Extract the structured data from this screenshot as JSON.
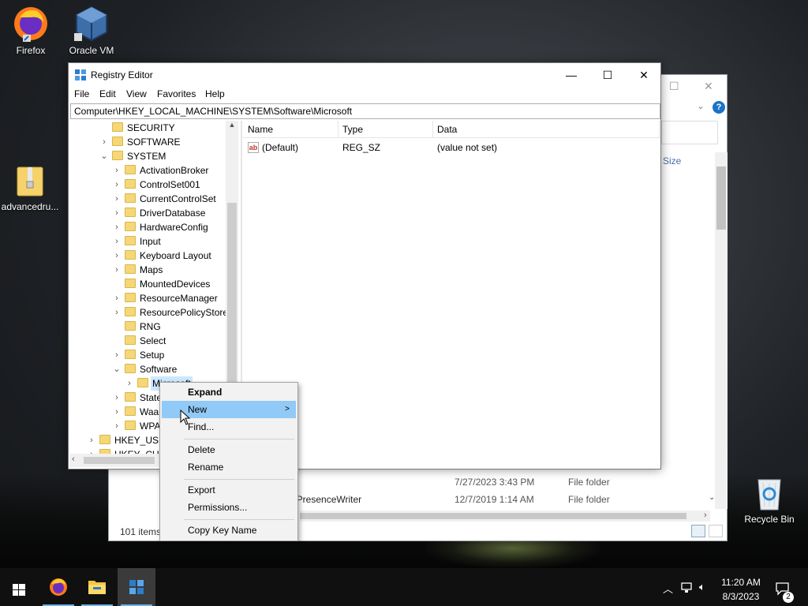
{
  "desktop": {
    "icons": [
      {
        "label": "Firefox"
      },
      {
        "label": "Oracle VM VirtualBox"
      },
      {
        "label": "advancedru..."
      },
      {
        "label": "Recycle Bin"
      }
    ]
  },
  "explorer": {
    "column_size": "Size",
    "rows": [
      {
        "name": "",
        "date": "7/27/2023 3:43 PM",
        "type": "File folder"
      },
      {
        "name": "arPresenceWriter",
        "date": "12/7/2019 1:14 AM",
        "type": "File folder"
      }
    ],
    "status": "101 items"
  },
  "regedit": {
    "title": "Registry Editor",
    "menu": [
      "File",
      "Edit",
      "View",
      "Favorites",
      "Help"
    ],
    "address": "Computer\\HKEY_LOCAL_MACHINE\\SYSTEM\\Software\\Microsoft",
    "tree": [
      {
        "label": "SECURITY",
        "arrow": ""
      },
      {
        "label": "SOFTWARE",
        "arrow": ">"
      },
      {
        "label": "SYSTEM",
        "arrow": "v"
      },
      {
        "label": "ActivationBroker",
        "arrow": ">"
      },
      {
        "label": "ControlSet001",
        "arrow": ">"
      },
      {
        "label": "CurrentControlSet",
        "arrow": ">"
      },
      {
        "label": "DriverDatabase",
        "arrow": ">"
      },
      {
        "label": "HardwareConfig",
        "arrow": ">"
      },
      {
        "label": "Input",
        "arrow": ">"
      },
      {
        "label": "Keyboard Layout",
        "arrow": ">"
      },
      {
        "label": "Maps",
        "arrow": ">"
      },
      {
        "label": "MountedDevices",
        "arrow": ""
      },
      {
        "label": "ResourceManager",
        "arrow": ">"
      },
      {
        "label": "ResourcePolicyStore",
        "arrow": ">"
      },
      {
        "label": "RNG",
        "arrow": ""
      },
      {
        "label": "Select",
        "arrow": ""
      },
      {
        "label": "Setup",
        "arrow": ">"
      },
      {
        "label": "Software",
        "arrow": "v"
      },
      {
        "label": "Microsoft",
        "arrow": ">"
      },
      {
        "label": "State",
        "arrow": ">"
      },
      {
        "label": "WaaS",
        "arrow": ">"
      },
      {
        "label": "WPA",
        "arrow": ">"
      },
      {
        "label": "HKEY_USERS",
        "arrow": ">"
      },
      {
        "label": "HKEY_CURRENT_CONFIG",
        "arrow": ">"
      }
    ],
    "columns": {
      "name": "Name",
      "type": "Type",
      "data": "Data"
    },
    "values": [
      {
        "name": "(Default)",
        "type": "REG_SZ",
        "data": "(value not set)"
      }
    ]
  },
  "context_menu": {
    "items": [
      {
        "label": "Expand",
        "bold": true
      },
      {
        "label": "New",
        "submenu": ">"
      },
      {
        "label": "Find..."
      },
      {
        "label": "Delete"
      },
      {
        "label": "Rename"
      },
      {
        "label": "Export"
      },
      {
        "label": "Permissions..."
      },
      {
        "label": "Copy Key Name"
      }
    ]
  },
  "taskbar": {
    "time": "11:20 AM",
    "date": "8/3/2023",
    "notifications": "2"
  },
  "colors": {
    "accent": "#0078d7",
    "menu_highlight": "#91c9f7",
    "selected_key": "#cce8ff"
  }
}
